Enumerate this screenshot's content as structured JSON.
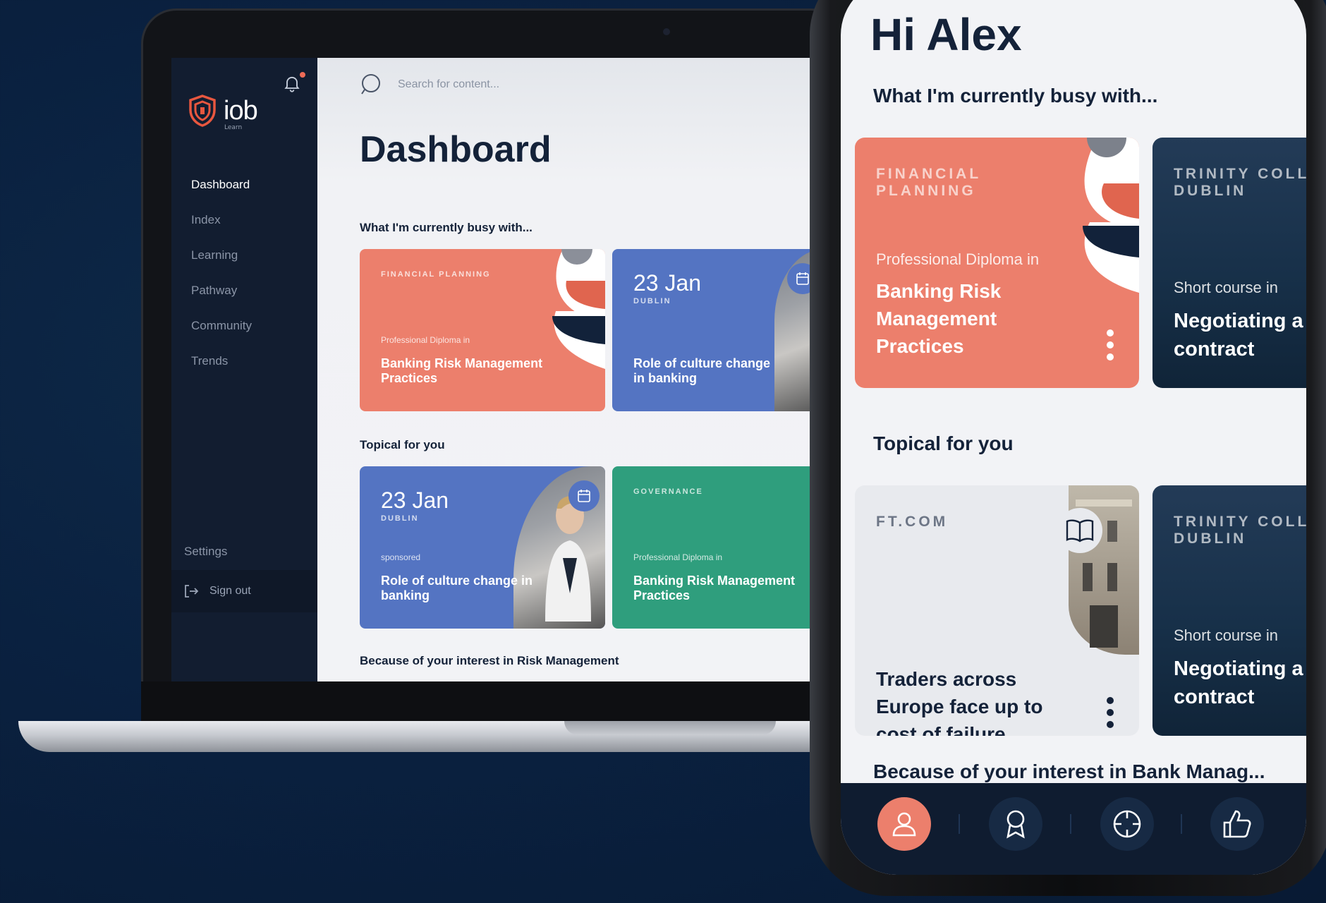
{
  "laptop": {
    "sidebar": {
      "logo_text": "iob",
      "logo_sub": "Learn",
      "nav": [
        "Dashboard",
        "Index",
        "Learning",
        "Pathway",
        "Community",
        "Trends"
      ],
      "active": "Dashboard",
      "settings": "Settings",
      "sign_out": "Sign out"
    },
    "search_placeholder": "Search for content...",
    "title": "Dashboard",
    "sections": {
      "busy": "What I'm currently busy with...",
      "topical": "Topical for you",
      "interest": "Because of your interest in Risk Management"
    },
    "busy_cards": [
      {
        "eyebrow": "FINANCIAL PLANNING",
        "pre": "Professional Diploma in",
        "title": "Banking Risk Management Practices"
      },
      {
        "date": "23 Jan",
        "place": "DUBLIN",
        "title": "Role of culture change in banking"
      }
    ],
    "topical_cards": [
      {
        "date": "23 Jan",
        "place": "DUBLIN",
        "pre": "sponsored",
        "title": "Role of culture change in banking"
      },
      {
        "eyebrow": "GOVERNANCE",
        "pre": "Professional Diploma in",
        "title": "Banking Risk Management Practices"
      }
    ]
  },
  "phone": {
    "greeting": "Hi Alex",
    "sections": {
      "busy": "What I'm currently busy with...",
      "topical": "Topical for you",
      "interest": "Because of your interest in Bank Manag..."
    },
    "busy_cards": [
      {
        "eyebrow": "FINANCIAL PLANNING",
        "pre": "Professional Diploma in",
        "title": "Banking Risk Management Practices"
      },
      {
        "eyebrow": "TRINITY COLL DUBLIN",
        "pre": "Short course in",
        "title": "Negotiating a contract"
      }
    ],
    "topical_cards": [
      {
        "eyebrow": "FT.COM",
        "title": "Traders across Europe face up to cost of failure"
      },
      {
        "eyebrow": "TRINITY COLL DUBLIN",
        "pre": "Short course in",
        "title": "Negotiating a contract"
      }
    ],
    "tabbar_icons": [
      "profile-icon",
      "award-icon",
      "target-icon",
      "thumbs-up-icon"
    ]
  },
  "colors": {
    "coral": "#ec7f6c",
    "blue": "#5474c2",
    "green": "#2f9e7d",
    "navy": "#142239",
    "background": "#0a2140"
  }
}
